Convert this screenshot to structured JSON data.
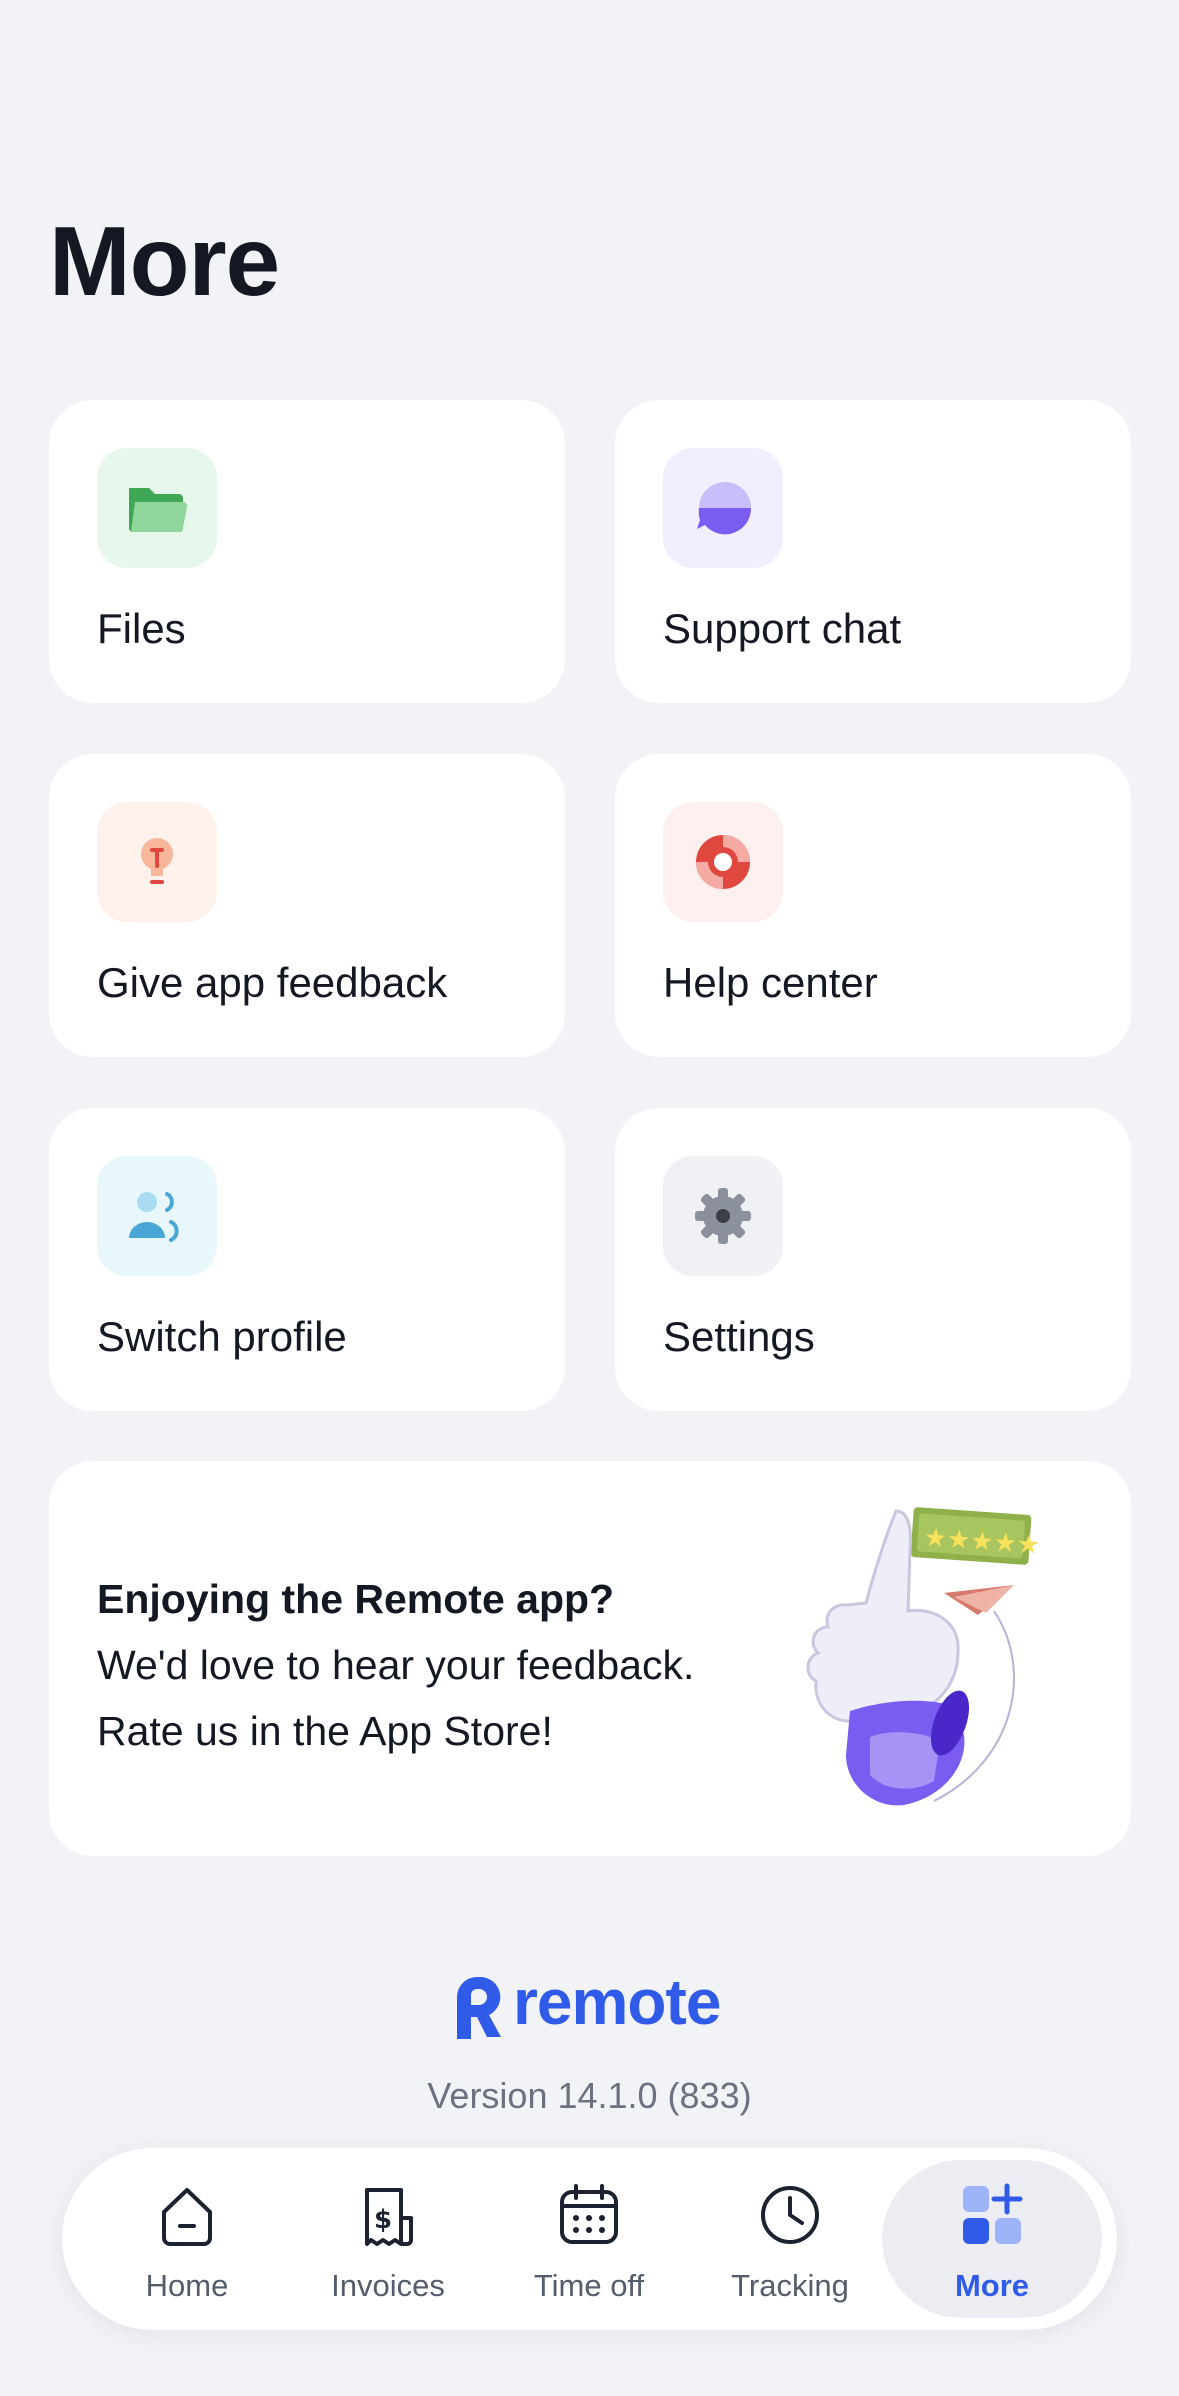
{
  "page": {
    "title": "More"
  },
  "tiles": [
    {
      "label": "Files",
      "icon": "folder-icon",
      "bg": "#e8f7ec",
      "color": "#3fa653"
    },
    {
      "label": "Support chat",
      "icon": "chat-bubble-icon",
      "bg": "#f1efff",
      "color": "#7b5cf0"
    },
    {
      "label": "Give app feedback",
      "icon": "lightbulb-icon",
      "bg": "#fff2ec",
      "color": "#f0774c"
    },
    {
      "label": "Help center",
      "icon": "lifebuoy-icon",
      "bg": "#fff0f0",
      "color": "#e0483f"
    },
    {
      "label": "Switch profile",
      "icon": "switch-profile-icon",
      "bg": "#e8f7fc",
      "color": "#4aa6d6"
    },
    {
      "label": "Settings",
      "icon": "gear-icon",
      "bg": "#f0f1f4",
      "color": "#8a909c"
    }
  ],
  "banner": {
    "title": "Enjoying the Remote app?",
    "line1": "We'd love to hear your feedback.",
    "line2": "Rate us in the App Store!",
    "illustration": "thumbs-up-rating-illustration"
  },
  "brand": {
    "name": "remote",
    "color": "#2f5be8"
  },
  "version": "Version 14.1.0 (833)",
  "tabs": [
    {
      "label": "Home",
      "icon": "home-icon"
    },
    {
      "label": "Invoices",
      "icon": "invoice-icon"
    },
    {
      "label": "Time off",
      "icon": "calendar-icon"
    },
    {
      "label": "Tracking",
      "icon": "clock-icon"
    },
    {
      "label": "More",
      "icon": "more-grid-icon",
      "active": true
    }
  ]
}
